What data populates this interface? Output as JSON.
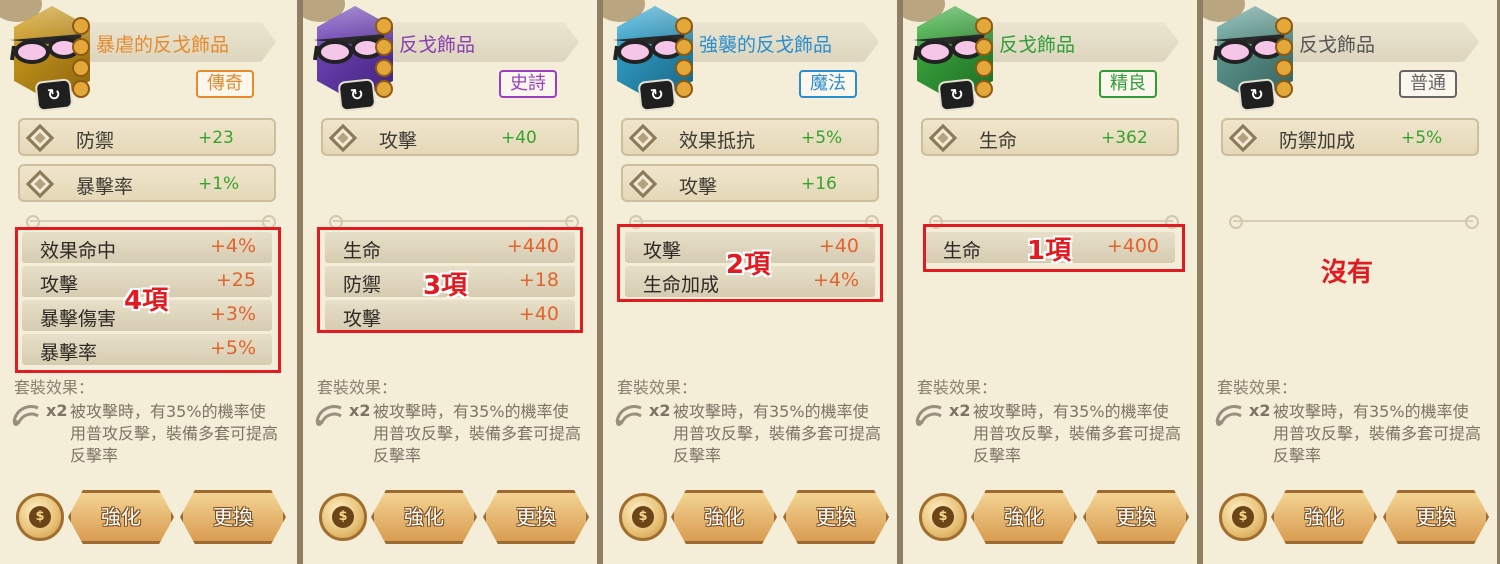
{
  "cards": [
    {
      "item_name": "暴虐的反戈飾品",
      "name_color": "#e58a2e",
      "rarity": "傳奇",
      "rarity_color": "#e58a2e",
      "portrait_color": "#d6a21e",
      "portrait_dark": "#8a6410",
      "main_stats": [
        {
          "label": "防禦",
          "value": "+23"
        },
        {
          "label": "暴擊率",
          "value": "+1%"
        }
      ],
      "sub_stats": [
        {
          "label": "效果命中",
          "value": "+4%"
        },
        {
          "label": "攻擊",
          "value": "+25"
        },
        {
          "label": "暴擊傷害",
          "value": "+3%"
        },
        {
          "label": "暴擊率",
          "value": "+5%"
        }
      ],
      "count_label": "4項"
    },
    {
      "item_name": "反戈飾品",
      "name_color": "#8a3fb0",
      "rarity": "史詩",
      "rarity_color": "#9a3fc0",
      "portrait_color": "#7b4fc4",
      "portrait_dark": "#3f1f7a",
      "main_stats": [
        {
          "label": "攻擊",
          "value": "+40"
        }
      ],
      "sub_stats": [
        {
          "label": "生命",
          "value": "+440"
        },
        {
          "label": "防禦",
          "value": "+18"
        },
        {
          "label": "攻擊",
          "value": "+40"
        }
      ],
      "count_label": "3項"
    },
    {
      "item_name": "強襲的反戈飾品",
      "name_color": "#2a8fd0",
      "rarity": "魔法",
      "rarity_color": "#2a8fd0",
      "portrait_color": "#3ab0da",
      "portrait_dark": "#16617f",
      "main_stats": [
        {
          "label": "效果抵抗",
          "value": "+5%"
        },
        {
          "label": "攻擊",
          "value": "+16"
        }
      ],
      "sub_stats": [
        {
          "label": "攻擊",
          "value": "+40"
        },
        {
          "label": "生命加成",
          "value": "+4%"
        }
      ],
      "count_label": "2項"
    },
    {
      "item_name": "反戈飾品",
      "name_color": "#2f9e3a",
      "rarity": "精良",
      "rarity_color": "#2f9e3a",
      "portrait_color": "#43b545",
      "portrait_dark": "#1c6a22",
      "main_stats": [
        {
          "label": "生命",
          "value": "+362"
        }
      ],
      "sub_stats": [
        {
          "label": "生命",
          "value": "+400"
        }
      ],
      "count_label": "1項"
    },
    {
      "item_name": "反戈飾品",
      "name_color": "#555555",
      "rarity": "普通",
      "rarity_color": "#666666",
      "portrait_color": "#6aa8a0",
      "portrait_dark": "#345f58",
      "main_stats": [
        {
          "label": "防禦加成",
          "value": "+5%"
        }
      ],
      "sub_stats": [],
      "count_label": "沒有"
    }
  ],
  "set_effect": {
    "title": "套裝效果：",
    "count": "x2",
    "description": "被攻擊時，有35%的機率使用普攻反擊，裝備多套可提高反擊率",
    "icon": "counterattack-icon"
  },
  "buttons": {
    "enhance": "強化",
    "replace": "更換"
  },
  "icons": {
    "set": "set-badge-icon",
    "coin": "money-bag-icon",
    "item": "glasses-icon"
  }
}
